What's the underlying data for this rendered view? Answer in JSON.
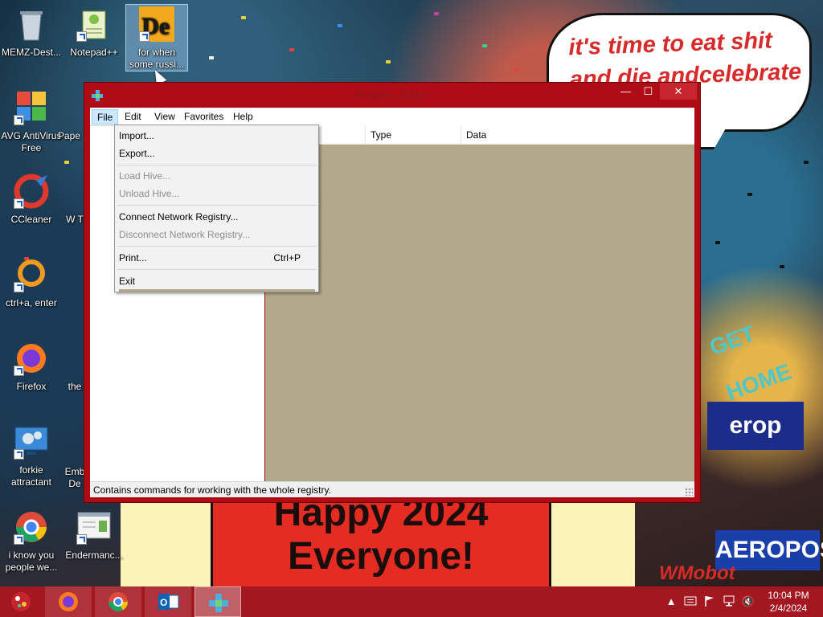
{
  "wallpaper": {
    "bubble_text": "it's time to eat shit and die andcelebrate",
    "poster_text": "Happy 2024 Everyone!",
    "sign_1": "erop",
    "sign_2": "AEROPOS",
    "sign_3": "GET HOME",
    "watermark": "WMobot"
  },
  "desktop_icons": [
    {
      "label": "MEMZ-Dest...",
      "icon": "recycle-bin-icon"
    },
    {
      "label": "Notepad++",
      "icon": "notepad-plus-plus-icon"
    },
    {
      "label": "for when some russi...",
      "icon": "die-app-icon"
    },
    {
      "label": "AVG AntiVirus Free",
      "icon": "avg-antivirus-icon"
    },
    {
      "label": "Pape",
      "icon": "paper-icon"
    },
    {
      "label": "CCleaner",
      "icon": "ccleaner-icon"
    },
    {
      "label": "W T",
      "icon": "generic-app-icon"
    },
    {
      "label": "ctrl+a, enter",
      "icon": "orange-ring-icon"
    },
    {
      "label": "Firefox",
      "icon": "firefox-icon"
    },
    {
      "label": "the",
      "icon": "generic-app-icon"
    },
    {
      "label": "forkie attractant",
      "icon": "gears-monitor-icon"
    },
    {
      "label": "Emb De",
      "icon": "generic-app-icon"
    },
    {
      "label": "i know you people we...",
      "icon": "chrome-icon"
    },
    {
      "label": "Endermanc...",
      "icon": "document-window-icon"
    }
  ],
  "window": {
    "title": "Registry Editor",
    "buttons": {
      "minimize": "—",
      "maximize": "☐",
      "close": "✕"
    },
    "menus": [
      "File",
      "Edit",
      "View",
      "Favorites",
      "Help"
    ],
    "columns": [
      "Type",
      "Data"
    ],
    "status": "Contains commands for working with the whole registry."
  },
  "file_menu": {
    "import": "Import...",
    "export": "Export...",
    "load_hive": "Load Hive...",
    "unload_hive": "Unload Hive...",
    "connect": "Connect Network Registry...",
    "disconnect": "Disconnect Network Registry...",
    "print": "Print...",
    "print_shortcut": "Ctrl+P",
    "exit": "Exit"
  },
  "taskbar": {
    "apps": [
      "Firefox",
      "Chrome",
      "Outlook",
      "Registry Editor"
    ],
    "tray": {
      "chevron": "▲",
      "volume": "🔇"
    },
    "time": "10:04 PM",
    "date": "2/4/2024"
  },
  "colors": {
    "accent": "#b00c16",
    "taskbar": "#a31720",
    "list_bg": "#b3a98a",
    "menu_highlight": "#cce8ff"
  }
}
